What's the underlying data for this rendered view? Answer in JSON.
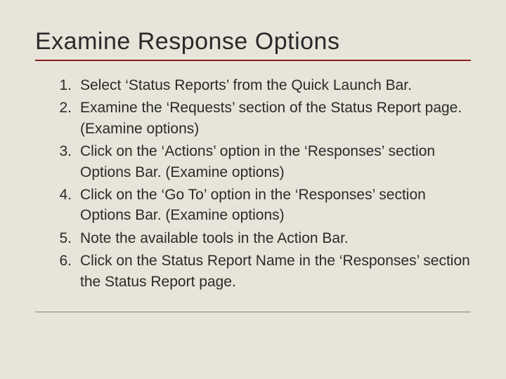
{
  "heading": "Examine Response Options",
  "items": [
    {
      "num": "1.",
      "text": "Select ‘Status Reports’ from the Quick Launch Bar."
    },
    {
      "num": "2.",
      "text": "Examine the ‘Requests’ section of the Status Report page.  (Examine options)"
    },
    {
      "num": "3.",
      "text": "Click on the ‘Actions’ option in the ‘Responses’ section Options Bar. (Examine options)"
    },
    {
      "num": "4.",
      "text": "Click on the ‘Go To’ option in the ‘Responses’ section Options Bar. (Examine options)"
    },
    {
      "num": "5.",
      "text": "Note the available tools in the Action Bar."
    },
    {
      "num": "6.",
      "text": "Click on the Status Report Name in the ‘Responses’ section the Status Report page."
    }
  ]
}
